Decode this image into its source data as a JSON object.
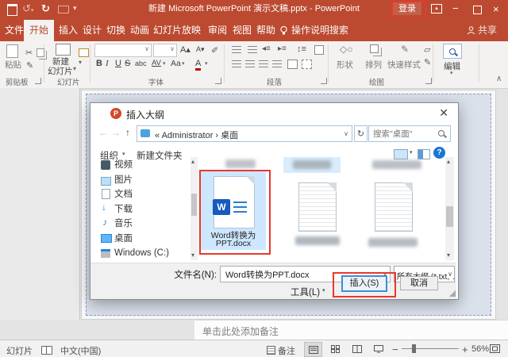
{
  "colors": {
    "titlebar": "#BB4A31",
    "accent_blue": "#0078D7",
    "annotation_red": "#E8392B",
    "selection_blue": "#CDE7FF"
  },
  "titlebar": {
    "title": "新建 Microsoft PowerPoint 演示文稿.pptx - PowerPoint",
    "signin": "登录",
    "share": "共享"
  },
  "tabs": [
    {
      "label": "文件"
    },
    {
      "label": "开始"
    },
    {
      "label": "插入"
    },
    {
      "label": "设计"
    },
    {
      "label": "切换"
    },
    {
      "label": "动画"
    },
    {
      "label": "幻灯片放映"
    },
    {
      "label": "审阅"
    },
    {
      "label": "视图"
    },
    {
      "label": "帮助"
    },
    {
      "label": "操作说明搜索"
    }
  ],
  "ribbon": {
    "paste": "粘贴",
    "clipboard": "剪贴板",
    "new_slide_1": "新建",
    "new_slide_2": "幻灯片",
    "slides": "幻灯片",
    "font": "字体",
    "bold": "B",
    "italic": "I",
    "underline": "U",
    "strike": "S",
    "abc": "abc",
    "av": "AV",
    "aa": "Aa",
    "fontcolor": "A",
    "paragraph": "段落",
    "shapes": "形状",
    "arrange": "排列",
    "quick_styles": "快速样式",
    "drawing": "绘图",
    "editing": "编辑"
  },
  "dialog": {
    "title": "插入大纲",
    "breadcrumb": "«  Administrator  ›  桌面",
    "search_placeholder": "搜索\"桌面\"",
    "organize": "组织",
    "new_folder": "新建文件夹",
    "sidebar": [
      {
        "label": "视频"
      },
      {
        "label": "图片"
      },
      {
        "label": "文档"
      },
      {
        "label": "下载"
      },
      {
        "label": "音乐"
      },
      {
        "label": "桌面"
      },
      {
        "label": "Windows (C:)"
      }
    ],
    "file_name_line1": "Word转换为",
    "file_name_line2": "PPT.docx",
    "filename_label": "文件名(N):",
    "filename_value": "Word转换为PPT.docx",
    "filetype_value": "所有大纲 (*.txt;*.rtf;*.docx;*.dc",
    "tools": "工具(L)",
    "insert": "插入(S)",
    "cancel": "取消"
  },
  "notes": {
    "placeholder": "单击此处添加备注"
  },
  "statusbar": {
    "slide": "幻灯片",
    "language": "中文(中国)",
    "notes": "备注",
    "zoom": "56%"
  }
}
